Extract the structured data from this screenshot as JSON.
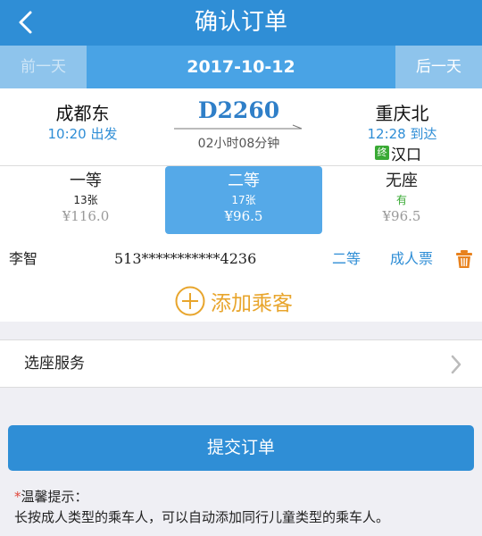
{
  "header": {
    "title": "确认订单"
  },
  "date_bar": {
    "prev_label": "前一天",
    "date": "2017-10-12",
    "next_label": "后一天"
  },
  "train": {
    "from_station": "成都东",
    "departure": "10:20 出发",
    "number": "D2260",
    "duration": "02小时08分钟",
    "to_station": "重庆北",
    "arrival": "12:28 到达",
    "terminus_badge": "终",
    "terminus_station": "汉口"
  },
  "seats": [
    {
      "name": "一等",
      "count": "13张",
      "price": "¥116.0",
      "selected": false
    },
    {
      "name": "二等",
      "count": "17张",
      "price": "¥96.5",
      "selected": true
    },
    {
      "name": "无座",
      "count": "有",
      "price": "¥96.5",
      "selected": false
    }
  ],
  "passenger": {
    "name": "李智",
    "id_number": "513***********4236",
    "seat_class": "二等",
    "ticket_type": "成人票"
  },
  "add_passenger": {
    "label": "添加乘客"
  },
  "seat_service": {
    "label": "选座服务"
  },
  "submit": {
    "label": "提交订单"
  },
  "tips": {
    "star": "*",
    "title": "温馨提示：",
    "text": "长按成人类型的乘车人，可以自动添加同行儿童类型的乘车人。"
  },
  "colors": {
    "primary": "#2f8ed6",
    "accent": "#e8a52c",
    "delete": "#e8821e",
    "terminus": "#3aaa35"
  },
  "icons": {
    "back": "chevron-left-icon",
    "delete": "trash-icon",
    "add": "plus-circle-icon",
    "next": "chevron-right-icon"
  }
}
